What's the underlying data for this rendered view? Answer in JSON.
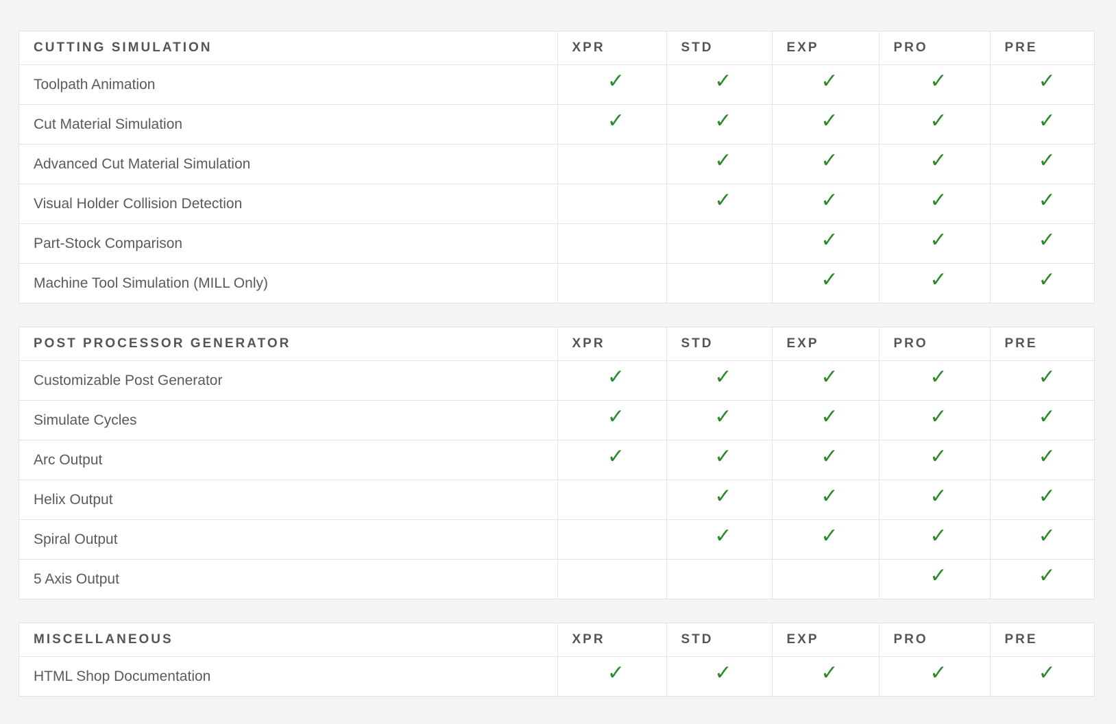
{
  "columns": [
    "XPR",
    "STD",
    "EXP",
    "PRO",
    "PRE"
  ],
  "check_symbol": "✓",
  "check_color": "#2a8a2a",
  "sections": [
    {
      "title": "CUTTING SIMULATION",
      "rows": [
        {
          "feature": "Toolpath Animation",
          "marks": [
            true,
            true,
            true,
            true,
            true
          ]
        },
        {
          "feature": "Cut Material Simulation",
          "marks": [
            true,
            true,
            true,
            true,
            true
          ]
        },
        {
          "feature": "Advanced Cut Material Simulation",
          "marks": [
            false,
            true,
            true,
            true,
            true
          ]
        },
        {
          "feature": "Visual Holder Collision Detection",
          "marks": [
            false,
            true,
            true,
            true,
            true
          ]
        },
        {
          "feature": "Part-Stock Comparison",
          "marks": [
            false,
            false,
            true,
            true,
            true
          ]
        },
        {
          "feature": "Machine Tool Simulation (MILL Only)",
          "marks": [
            false,
            false,
            true,
            true,
            true
          ]
        }
      ]
    },
    {
      "title": "POST PROCESSOR GENERATOR",
      "rows": [
        {
          "feature": "Customizable Post Generator",
          "marks": [
            true,
            true,
            true,
            true,
            true
          ]
        },
        {
          "feature": "Simulate Cycles",
          "marks": [
            true,
            true,
            true,
            true,
            true
          ]
        },
        {
          "feature": "Arc Output",
          "marks": [
            true,
            true,
            true,
            true,
            true
          ]
        },
        {
          "feature": "Helix Output",
          "marks": [
            false,
            true,
            true,
            true,
            true
          ]
        },
        {
          "feature": "Spiral Output",
          "marks": [
            false,
            true,
            true,
            true,
            true
          ]
        },
        {
          "feature": "5 Axis Output",
          "marks": [
            false,
            false,
            false,
            true,
            true
          ]
        }
      ]
    },
    {
      "title": "MISCELLANEOUS",
      "rows": [
        {
          "feature": "HTML Shop Documentation",
          "marks": [
            true,
            true,
            true,
            true,
            true
          ]
        }
      ]
    }
  ]
}
